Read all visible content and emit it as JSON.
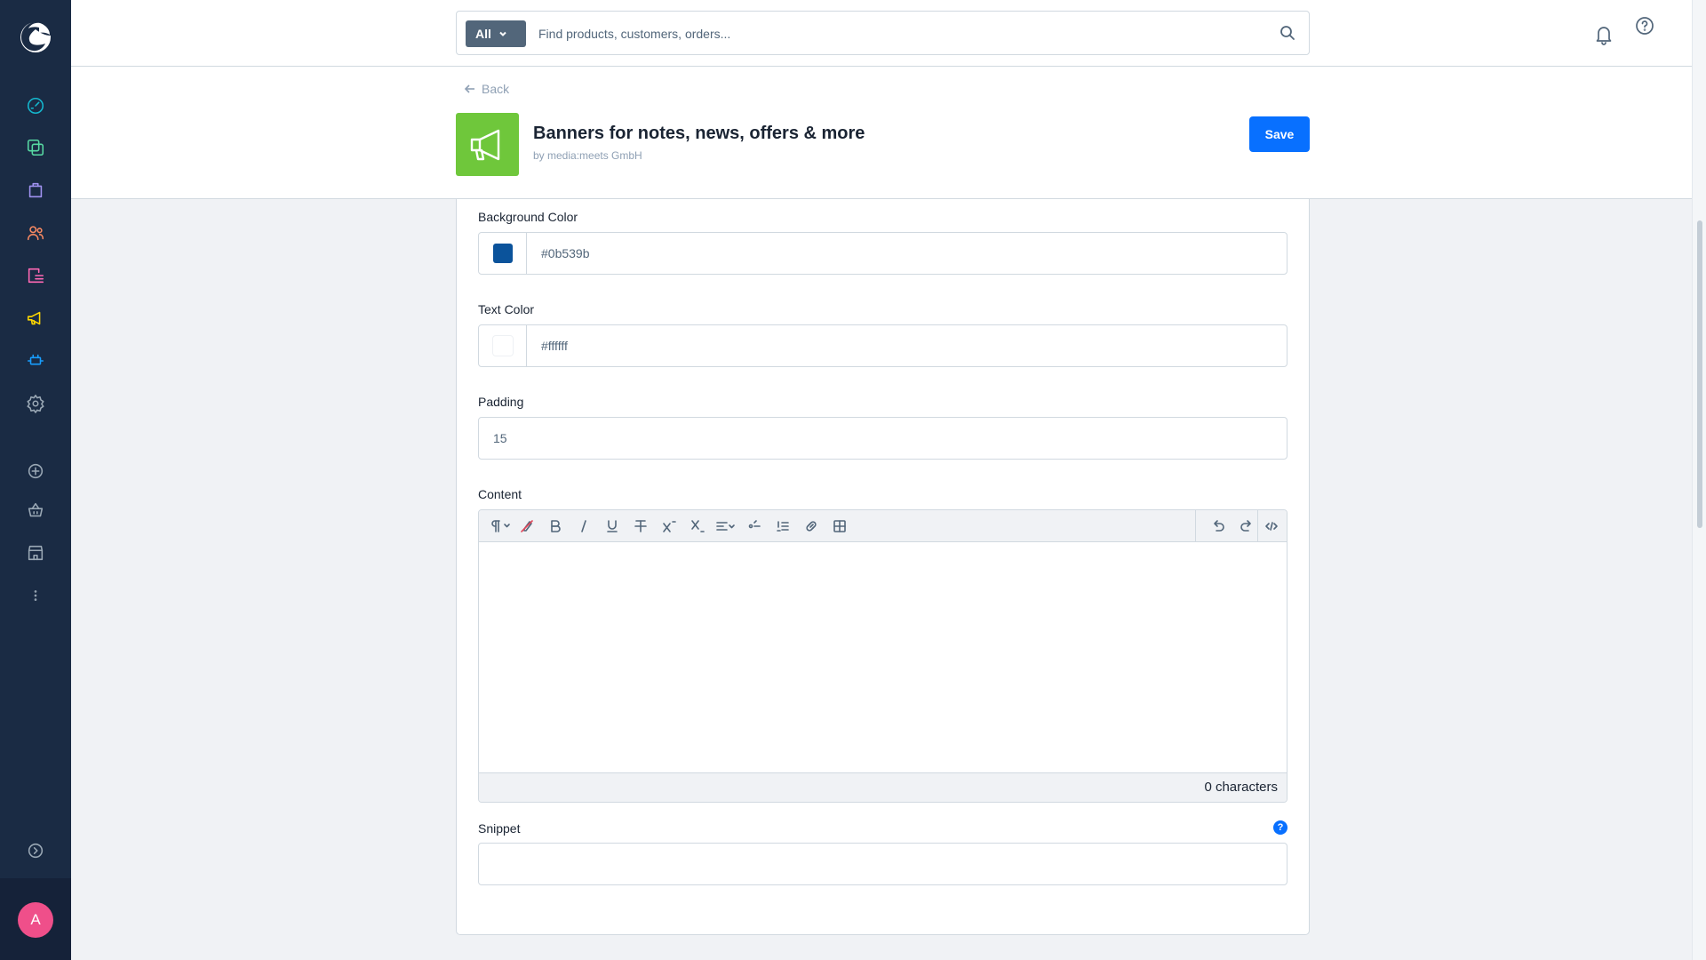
{
  "sidebar": {
    "items": [
      {
        "name": "dashboard-icon",
        "color": "#14b8cf"
      },
      {
        "name": "catalogue-icon",
        "color": "#57d9a3"
      },
      {
        "name": "orders-icon",
        "color": "#a092f0"
      },
      {
        "name": "customers-icon",
        "color": "#f88962"
      },
      {
        "name": "content-icon",
        "color": "#ff68b4"
      },
      {
        "name": "marketing-icon",
        "color": "#ffd700"
      },
      {
        "name": "extensions-icon",
        "color": "#189eff"
      },
      {
        "name": "settings-icon",
        "color": "#9aa8b5"
      },
      {
        "name": "add-icon",
        "color": "#9aa8b5"
      },
      {
        "name": "basket-icon",
        "color": "#9aa8b5"
      },
      {
        "name": "store-icon",
        "color": "#9aa8b5"
      },
      {
        "name": "more-icon",
        "color": "#9aa8b5"
      },
      {
        "name": "expand-icon",
        "color": "#9aa8b5"
      }
    ],
    "avatar_initial": "A",
    "avatar_color": "#ef4f8a"
  },
  "search": {
    "type_label": "All",
    "placeholder": "Find products, customers, orders..."
  },
  "header": {
    "back_label": "Back",
    "app_title": "Banners for notes, news, offers & more",
    "app_vendor": "by media:meets GmbH",
    "app_icon_color": "#6fc73b",
    "save_label": "Save"
  },
  "form": {
    "background_color": {
      "label": "Background Color",
      "value": "#0b539b"
    },
    "text_color": {
      "label": "Text Color",
      "value": "#ffffff"
    },
    "padding": {
      "label": "Padding",
      "value": "15"
    },
    "content": {
      "label": "Content",
      "char_count": "0 characters"
    },
    "snippet": {
      "label": "Snippet",
      "value": "",
      "help": "?"
    }
  },
  "colors": {
    "accent": "#0870ff",
    "sidebar_bg": "#1a2b44"
  }
}
